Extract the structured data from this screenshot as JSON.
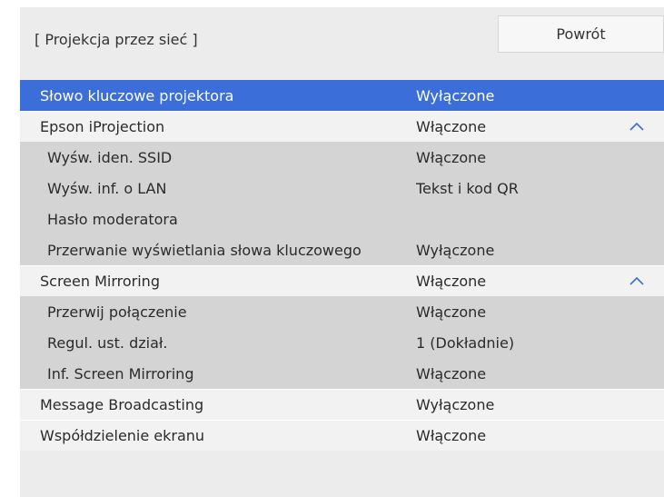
{
  "header": {
    "title": "[ Projekcja przez sieć ]",
    "back_label": "Powrót"
  },
  "rows": [
    {
      "label": "Słowo kluczowe projektora",
      "value": "Wyłączone"
    },
    {
      "label": "Epson iProjection",
      "value": "Włączone",
      "icon": "chevron-up-icon"
    },
    {
      "label": "Wyśw. iden. SSID",
      "value": "Włączone"
    },
    {
      "label": "Wyśw. inf. o LAN",
      "value": "Tekst i kod QR"
    },
    {
      "label": "Hasło moderatora",
      "value": ""
    },
    {
      "label": "Przerwanie wyświetlania słowa kluczowego",
      "value": "Wyłączone"
    },
    {
      "label": "Screen Mirroring",
      "value": "Włączone",
      "icon": "chevron-up-icon"
    },
    {
      "label": "Przerwij połączenie",
      "value": "Włączone"
    },
    {
      "label": "Regul. ust. dział.",
      "value": "1 (Dokładnie)"
    },
    {
      "label": "Inf. Screen Mirroring",
      "value": "Włączone"
    },
    {
      "label": "Message Broadcasting",
      "value": "Wyłączone"
    },
    {
      "label": "Współdzielenie ekranu",
      "value": "Włączone"
    }
  ],
  "colors": {
    "selected": "#3c6ed9",
    "main_row": "#f2f2f2",
    "sub_row": "#d4d4d4"
  }
}
